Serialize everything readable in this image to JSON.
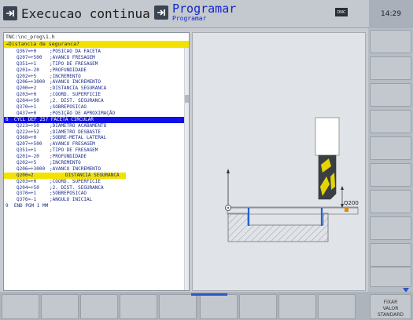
{
  "header": {
    "left_mode": "Execucao continua",
    "right_mode": "Programar",
    "right_sub": "Programar",
    "dnc": "DNC",
    "clock": "14:29"
  },
  "program": {
    "path": "TNC:\\nc_prog\\1.h",
    "prompt": "→Distancia de seguranca?",
    "lines": [
      {
        "code": "Q367=+0",
        "comment": ";POSICAO DA FACETA"
      },
      {
        "code": "Q207=+500",
        "comment": ";AVANCO FRESAGEM"
      },
      {
        "code": "Q351=+1",
        "comment": ";TIPO DE FRESAGEM"
      },
      {
        "code": "Q201=-20",
        "comment": ";PROFUNDIDADE"
      },
      {
        "code": "Q202=+5",
        "comment": ";INCREMENTO"
      },
      {
        "code": "Q206=+3000",
        "comment": ";AVANCO INCREMENTO"
      },
      {
        "code": "Q200=+2",
        "comment": ";DISTANCIA SEGURANCA"
      },
      {
        "code": "Q203=+0",
        "comment": ";COORD. SUPERFICIE"
      },
      {
        "code": "Q204=+50",
        "comment": ";2. DIST. SEGURANCA"
      },
      {
        "code": "Q370=+1",
        "comment": ";SOBREPOSICAO"
      },
      {
        "code": "Q437=+0",
        "comment": ";POSIÇÃO DE APROXIMAÇÃO"
      },
      {
        "code": "8  CYCL DEF 257 FACETA CIRCULAR",
        "comment": "",
        "type": "cycle"
      },
      {
        "code": "Q223=+50",
        "comment": ";DIAMETRO ACABAMENTO"
      },
      {
        "code": "Q222=+52",
        "comment": ";DIAMETRO DESBASTE"
      },
      {
        "code": "Q368=+0",
        "comment": ";SOBRE-METAL LATERAL"
      },
      {
        "code": "Q207=+500",
        "comment": ";AVANCO FRESAGEM"
      },
      {
        "code": "Q351=+1",
        "comment": ";TIPO DE FRESAGEM"
      },
      {
        "code": "Q201=-20",
        "comment": ";PROFUNDIDADE"
      },
      {
        "code": "Q202=+5",
        "comment": ";INCREMENTO"
      },
      {
        "code": "Q206=+3000",
        "comment": ";AVANCO INCREMENTO"
      },
      {
        "code": "Q200=2",
        "comment": "DISTANCIA SEGURANCA",
        "type": "selected"
      },
      {
        "code": "Q203=+0",
        "comment": ";COORD. SUPERFICIE"
      },
      {
        "code": "Q204=+50",
        "comment": ";2. DIST. SEGURANCA"
      },
      {
        "code": "Q370=+1",
        "comment": ";SOBREPOSICAO"
      },
      {
        "code": "Q376=-1",
        "comment": ";ANGULO INICIAL"
      },
      {
        "code": "9  END PGM 1 MM",
        "comment": "",
        "type": "end"
      }
    ]
  },
  "graphic": {
    "label": "Q200",
    "accent": "#1f62d6",
    "marker_color": "#e08a00"
  },
  "softkeys": {
    "fixar_line1": "FIXAR",
    "fixar_line2": "VALOR",
    "fixar_line3": "STANDARD"
  },
  "colors": {
    "prompt_bg": "#f3e200",
    "cycle_bg": "#1010e8",
    "code_text": "#1b2c8a",
    "mode_right": "#1028c8"
  }
}
